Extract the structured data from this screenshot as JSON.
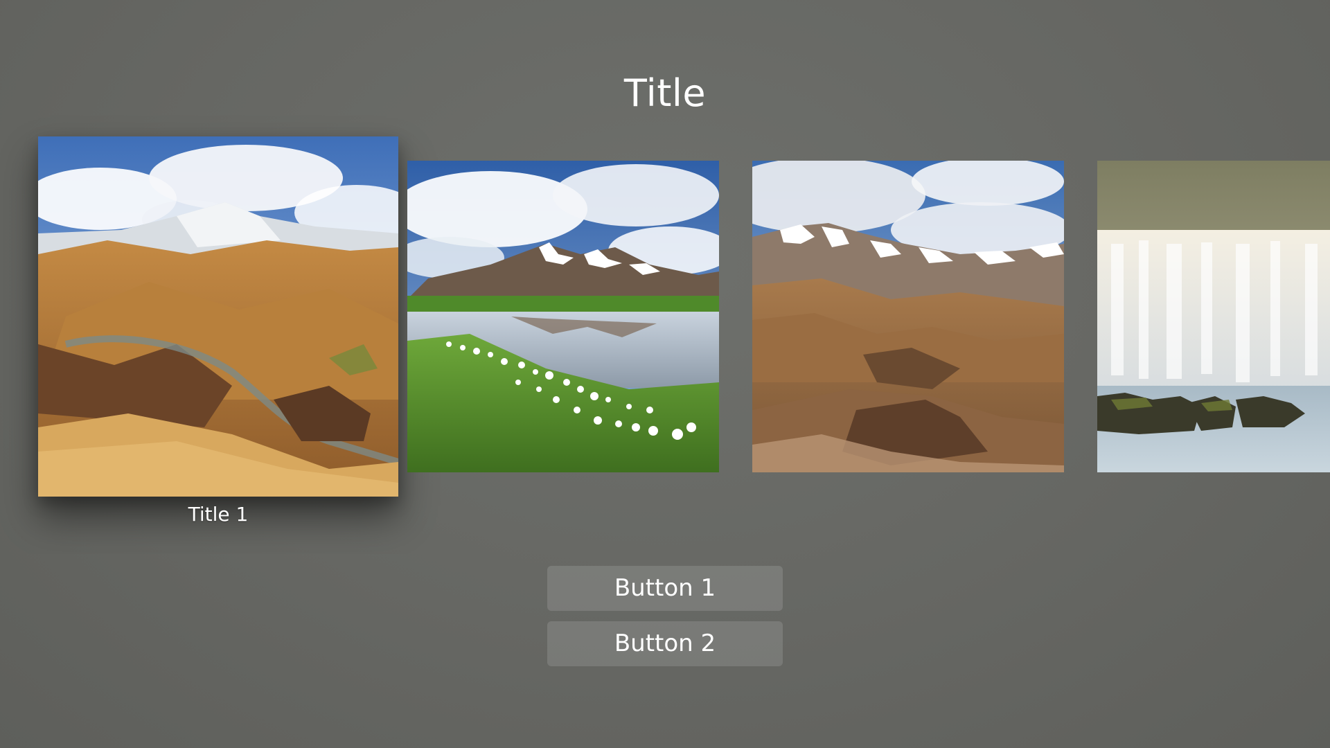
{
  "header": {
    "title": "Title"
  },
  "shelf": {
    "items": [
      {
        "caption": "Title 1",
        "image": "highland-rhyolite-mountains",
        "focused": true
      },
      {
        "caption": "",
        "image": "mountain-lake-cotton-grass",
        "focused": false
      },
      {
        "caption": "",
        "image": "snowy-ridge-valley",
        "focused": false
      },
      {
        "caption": "",
        "image": "waterfall-mist",
        "focused": false
      }
    ]
  },
  "actions": {
    "button_1": "Button 1",
    "button_2": "Button 2"
  },
  "colors": {
    "background": "#666763",
    "button_fill": "rgba(255,255,255,0.13)",
    "text": "#ffffff"
  }
}
